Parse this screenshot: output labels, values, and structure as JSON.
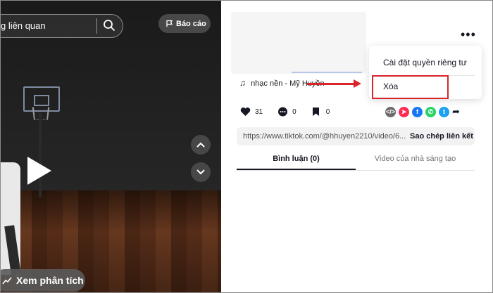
{
  "video": {
    "search_text": "g liên quan",
    "report_label": "Báo cáo",
    "analytics_label": "Xem phân tích"
  },
  "post": {
    "music": "nhạc nền - Mỹ Huyền",
    "likes": "31",
    "comments": "0",
    "saves": "0"
  },
  "menu": {
    "items": [
      "Cài đặt quyền riêng tư",
      "Xóa"
    ]
  },
  "link": {
    "url": "https://www.tiktok.com/@hhuyen2210/video/6...",
    "copy_label": "Sao chép liên kết"
  },
  "tabs": [
    "Bình luận (0)",
    "Video của nhà sáng tạo"
  ],
  "colors": {
    "highlight": "#d8242a",
    "facebook": "#1877f2",
    "whatsapp": "#25d366",
    "twitter": "#1da1f2",
    "telegram": "#fe2c55"
  }
}
